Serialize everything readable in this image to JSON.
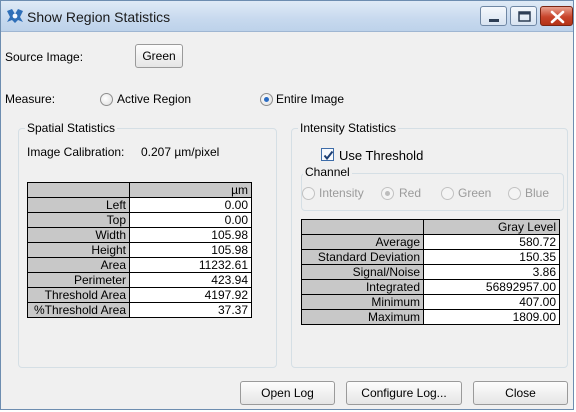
{
  "window": {
    "title": "Show Region Statistics",
    "controls": {
      "minimize": "minimize-icon",
      "maximize": "maximize-icon",
      "close": "close-icon"
    }
  },
  "source": {
    "label": "Source Image:",
    "button": "Green"
  },
  "measure": {
    "label": "Measure:",
    "options": [
      {
        "label": "Active Region",
        "selected": false
      },
      {
        "label": "Entire Image",
        "selected": true
      }
    ]
  },
  "spatial": {
    "title": "Spatial Statistics",
    "calibration_label": "Image Calibration:",
    "calibration_value": "0.207 µm/pixel",
    "unit_header": "µm",
    "rows": [
      {
        "name": "Left",
        "value": "0.00"
      },
      {
        "name": "Top",
        "value": "0.00"
      },
      {
        "name": "Width",
        "value": "105.98"
      },
      {
        "name": "Height",
        "value": "105.98"
      },
      {
        "name": "Area",
        "value": "11232.61"
      },
      {
        "name": "Perimeter",
        "value": "423.94"
      },
      {
        "name": "Threshold Area",
        "value": "4197.92"
      },
      {
        "name": "%Threshold Area",
        "value": "37.37"
      }
    ]
  },
  "intensity": {
    "title": "Intensity Statistics",
    "use_threshold": {
      "label": "Use Threshold",
      "checked": true
    },
    "channel": {
      "label": "Channel",
      "options": [
        {
          "label": "Intensity",
          "selected": false
        },
        {
          "label": "Red",
          "selected": true
        },
        {
          "label": "Green",
          "selected": false
        },
        {
          "label": "Blue",
          "selected": false
        }
      ]
    },
    "header": "Gray Level",
    "rows": [
      {
        "name": "Average",
        "value": "580.72"
      },
      {
        "name": "Standard Deviation",
        "value": "150.35"
      },
      {
        "name": "Signal/Noise",
        "value": "3.86"
      },
      {
        "name": "Integrated",
        "value": "56892957.00"
      },
      {
        "name": "Minimum",
        "value": "407.00"
      },
      {
        "name": "Maximum",
        "value": "1809.00"
      }
    ]
  },
  "buttons": {
    "open_log": "Open Log",
    "configure_log": "Configure Log...",
    "close": "Close"
  },
  "colors": {
    "selected_radio": "#2a6bc2",
    "close_button": "#c8442b",
    "header_cell": "#c8c8c8"
  }
}
